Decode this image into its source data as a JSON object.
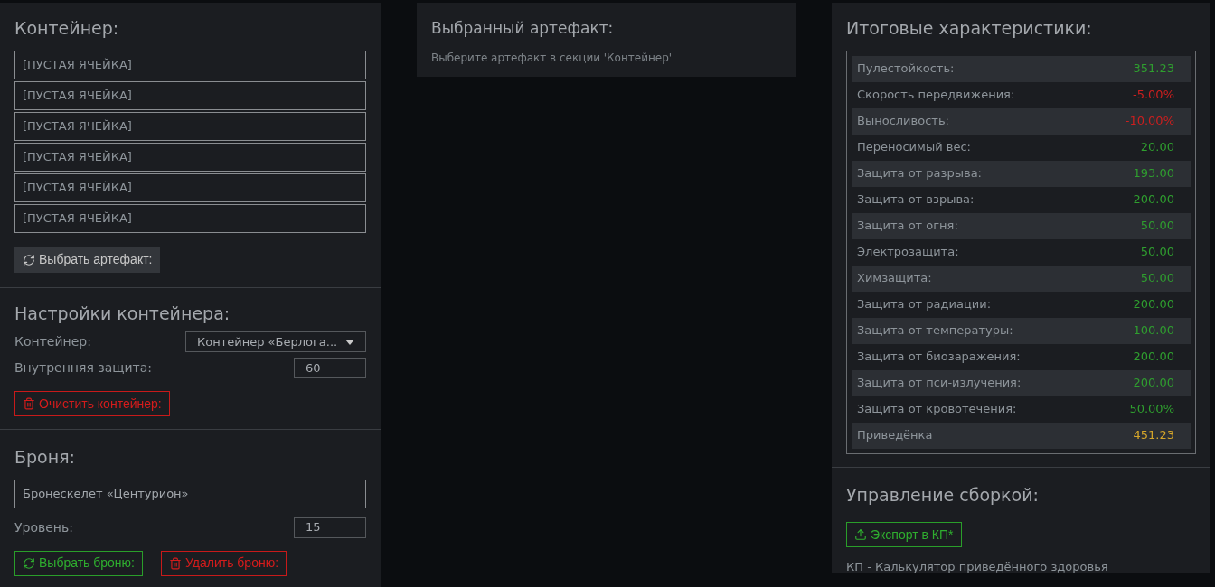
{
  "container": {
    "title": "Контейнер:",
    "slots": [
      "[ПУСТАЯ ЯЧЕЙКА]",
      "[ПУСТАЯ ЯЧЕЙКА]",
      "[ПУСТАЯ ЯЧЕЙКА]",
      "[ПУСТАЯ ЯЧЕЙКА]",
      "[ПУСТАЯ ЯЧЕЙКА]",
      "[ПУСТАЯ ЯЧЕЙКА]"
    ],
    "button": {
      "label": "Выбрать артефакт:",
      "kind": "select"
    }
  },
  "container_settings": {
    "title": "Настройки контейнера:",
    "container_label": "Контейнер:",
    "container_value": "Контейнер «Берлога...",
    "protection_label": "Внутренняя защита:",
    "protection_value": "60",
    "button": {
      "label": "Очистить контейнер:",
      "kind": "remove"
    }
  },
  "armor": {
    "title": "Броня:",
    "name": "Бронескелет «Центурион»",
    "level_label": "Уровень:",
    "level_value": "15",
    "buttons": [
      {
        "label": "Выбрать броню:",
        "kind": "choose"
      },
      {
        "label": "Удалить броню:",
        "kind": "remove"
      }
    ]
  },
  "selected_artifact": {
    "title": "Выбранный артефакт:",
    "hint": "Выберите артефакт в секции 'Контейнер'"
  },
  "totals": {
    "title": "Итоговые характеристики:",
    "rows": [
      {
        "label": "Пулестойкость:",
        "value": "351.23",
        "color": "#2f9e2f"
      },
      {
        "label": "Скорость передвижения:",
        "value": "-5.00%",
        "color": "#cc1f1f"
      },
      {
        "label": "Выносливость:",
        "value": "-10.00%",
        "color": "#cc1f1f"
      },
      {
        "label": "Переносимый вес:",
        "value": "20.00",
        "color": "#2f9e2f"
      },
      {
        "label": "Защита от разрыва:",
        "value": "193.00",
        "color": "#2f9e2f"
      },
      {
        "label": "Защита от взрыва:",
        "value": "200.00",
        "color": "#2f9e2f"
      },
      {
        "label": "Защита от огня:",
        "value": "50.00",
        "color": "#2f9e2f"
      },
      {
        "label": "Электрозащита:",
        "value": "50.00",
        "color": "#2f9e2f"
      },
      {
        "label": "Химзащита:",
        "value": "50.00",
        "color": "#2f9e2f"
      },
      {
        "label": "Защита от радиации:",
        "value": "200.00",
        "color": "#2f9e2f"
      },
      {
        "label": "Защита от температуры:",
        "value": "100.00",
        "color": "#2f9e2f"
      },
      {
        "label": "Защита от биозаражения:",
        "value": "200.00",
        "color": "#2f9e2f"
      },
      {
        "label": "Защита от пси-излучения:",
        "value": "200.00",
        "color": "#2f9e2f"
      },
      {
        "label": "Защита от кровотечения:",
        "value": "50.00%",
        "color": "#2f9e2f"
      },
      {
        "label": "Приведёнка",
        "value": "451.23",
        "color": "#d4a52a"
      }
    ]
  },
  "build": {
    "title": "Управление сборкой:",
    "button": {
      "label": "Экспорт в КП*",
      "kind": "export"
    },
    "note": "КП - Калькулятор приведённого здоровья"
  }
}
